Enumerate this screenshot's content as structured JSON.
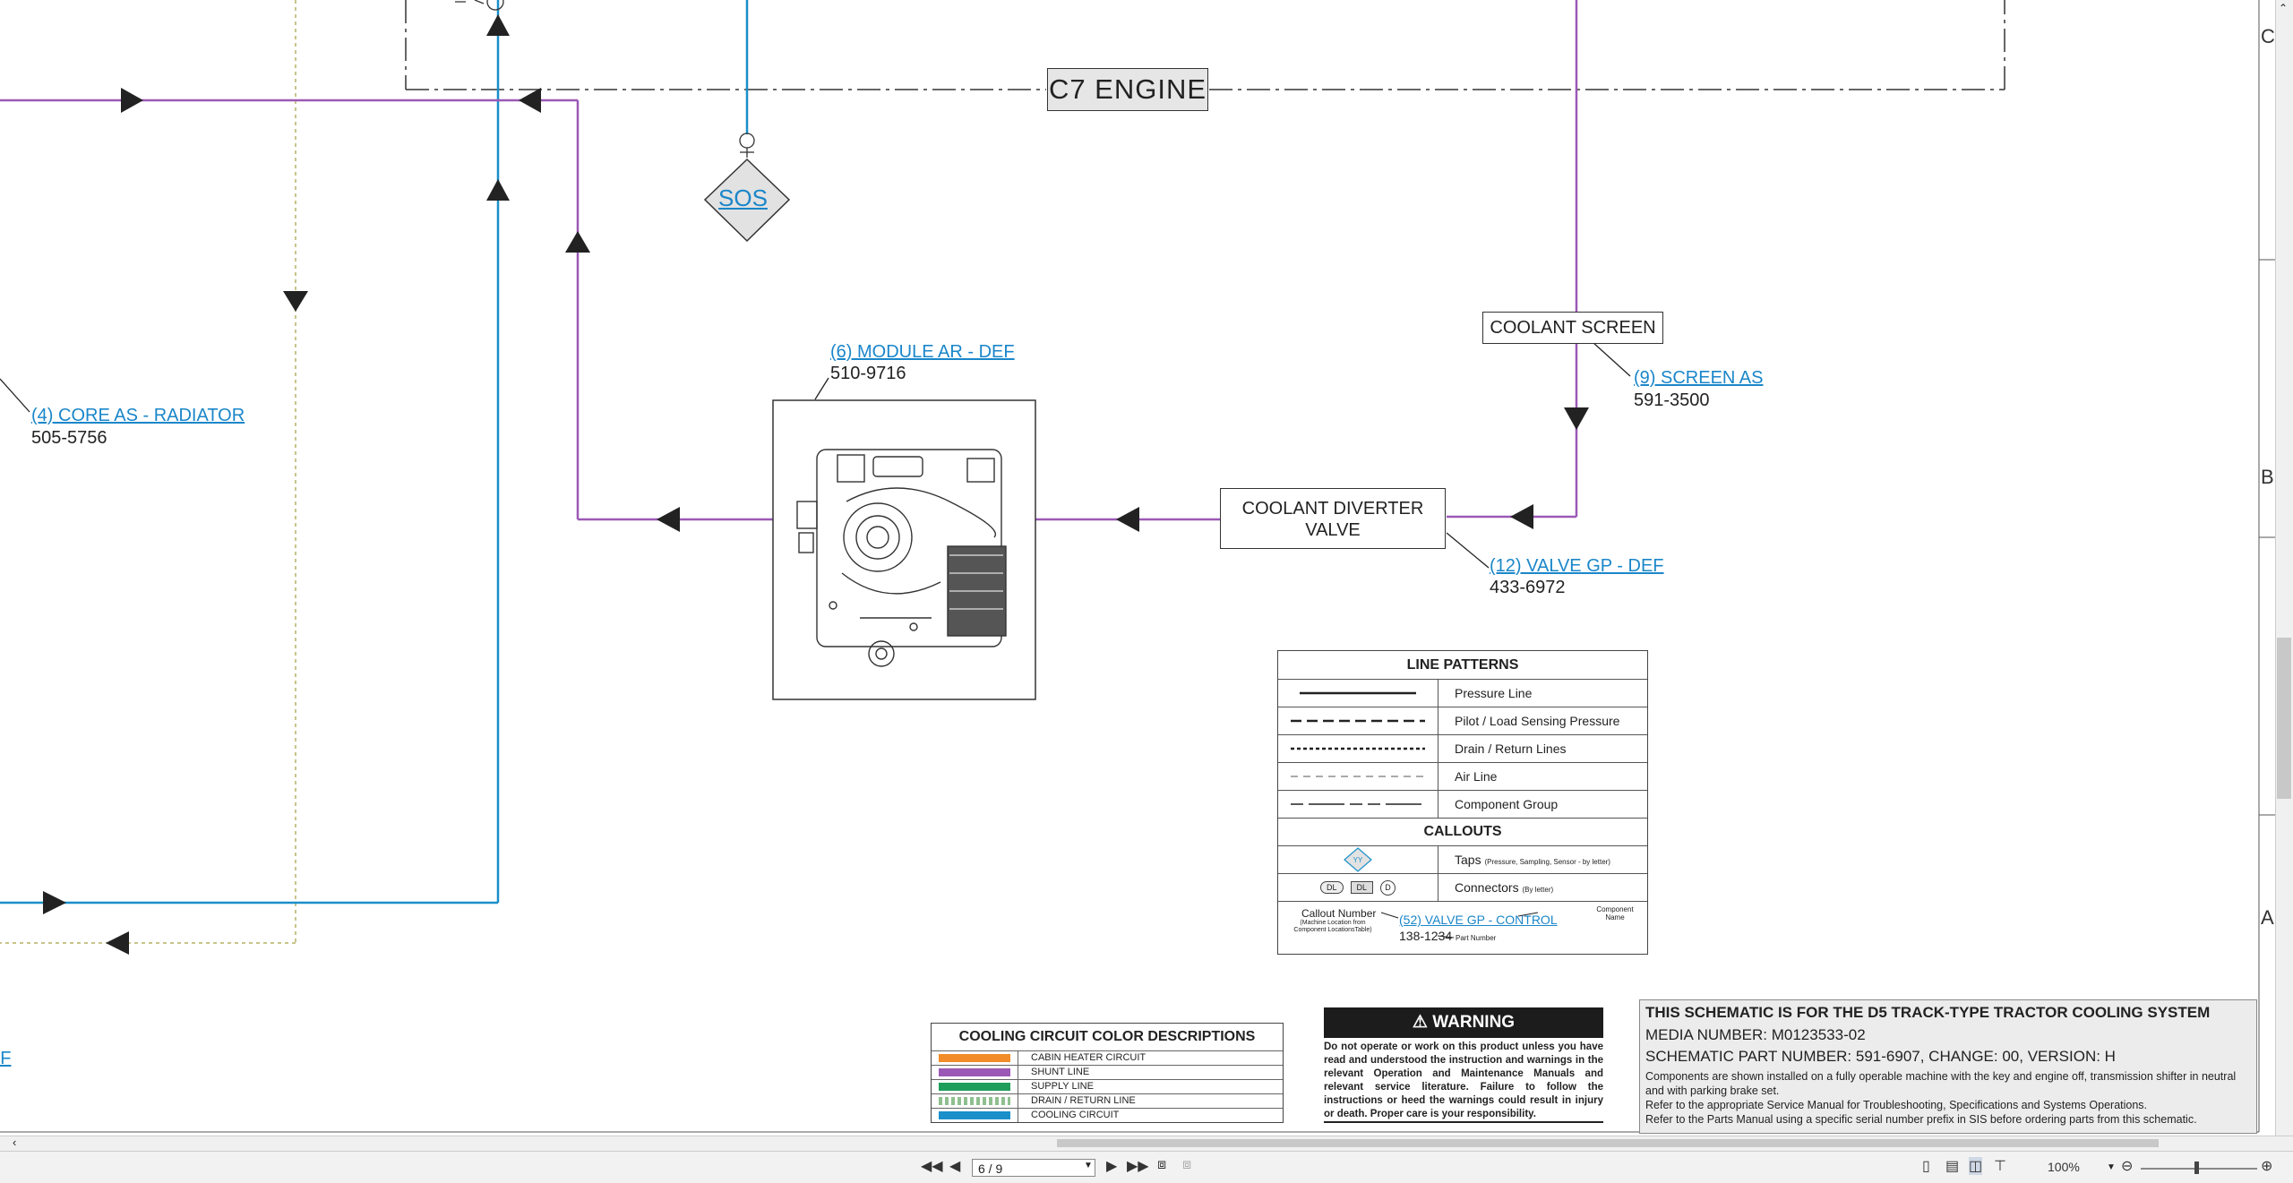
{
  "engine_label": "C7  ENGINE",
  "sos_label": "SOS",
  "components": {
    "radiator": {
      "name": "(4) CORE AS - RADIATOR",
      "part": "505-5756"
    },
    "module": {
      "name": "(6) MODULE AR - DEF",
      "part": "510-9716"
    },
    "screen": {
      "name": "(9) SCREEN AS",
      "part": "591-3500"
    },
    "valve": {
      "name": "(12) VALVE GP - DEF",
      "part": "433-6972"
    },
    "cut_link": "FF"
  },
  "boxes": {
    "coolant_screen": "COOLANT SCREEN",
    "diverter_line1": "COOLANT DIVERTER",
    "diverter_line2": "VALVE"
  },
  "legend": {
    "title": "LINE PATTERNS",
    "patterns": [
      "Pressure Line",
      "Pilot / Load Sensing Pressure",
      "Drain / Return Lines",
      "Air Line",
      "Component Group"
    ],
    "callouts_title": "CALLOUTS",
    "taps_label": "Taps",
    "taps_note": "(Pressure, Sampling, Sensor - by letter)",
    "tap_symbol": "YY",
    "connectors_label": "Connectors",
    "connectors_note": "(By letter)",
    "conn_dl": "DL",
    "conn_d": "D",
    "callout_number": "Callout Number",
    "callout_note": "(Machine Location from Component LocationsTable)",
    "example_name": "(52) VALVE GP - CONTROL",
    "example_part": "138-1234",
    "component_name": "Component Name",
    "part_number": "Part Number"
  },
  "color_desc": {
    "title": "COOLING CIRCUIT COLOR DESCRIPTIONS",
    "items": [
      {
        "label": "CABIN HEATER CIRCUIT",
        "color": "#f28c28"
      },
      {
        "label": "SHUNT LINE",
        "color": "#9b59b6"
      },
      {
        "label": "SUPPLY LINE",
        "color": "#1e9e5a"
      },
      {
        "label": "DRAIN / RETURN LINE",
        "color": "#8fbf8f"
      },
      {
        "label": "COOLING CIRCUIT",
        "color": "#1a8fc9"
      }
    ]
  },
  "warning": {
    "title": "WARNING",
    "body": "Do not operate or work on this product unless you have read and understood the instruction and warnings in the relevant Operation and Maintenance Manuals and relevant service literature. Failure to follow the instructions or heed the warnings could result in injury or death. Proper care is your responsibility."
  },
  "title_block": {
    "line1": "THIS SCHEMATIC IS FOR THE D5 TRACK-TYPE TRACTOR COOLING SYSTEM",
    "media": "MEDIA NUMBER: M0123533-02",
    "schematic": "SCHEMATIC PART NUMBER: 591-6907, CHANGE: 00, VERSION: H",
    "note1": "Components are shown installed on a fully operable machine with the key and engine off, transmission shifter in neutral and with parking brake set.",
    "note2": "Refer to the appropriate Service Manual for Troubleshooting, Specifications and Systems Operations.",
    "note3": "Refer to the Parts Manual using a specific serial number prefix in SIS before ordering parts from this schematic."
  },
  "zones": [
    "C",
    "B",
    "A"
  ],
  "toolbar": {
    "page": "6 / 9",
    "zoom": "100%"
  },
  "line_colors": {
    "shunt": "#9b59b6",
    "cooling": "#1a8fc9",
    "drain": "#c8c48a",
    "group": "#333333"
  }
}
